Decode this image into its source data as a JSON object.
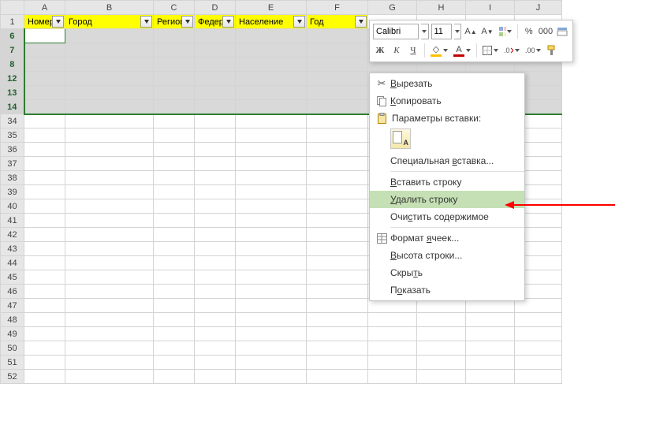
{
  "columns": [
    "A",
    "B",
    "C",
    "D",
    "E",
    "F",
    "G",
    "H",
    "I",
    "J"
  ],
  "header_row": "1",
  "titles": {
    "A": "Номер",
    "B": "Город",
    "C": "Регион",
    "D": "Федера",
    "E": "Население",
    "F": "Год"
  },
  "selected_rows": [
    "6",
    "7",
    "8",
    "12",
    "13",
    "14"
  ],
  "normal_rows": [
    "34",
    "35",
    "36",
    "37",
    "38",
    "39",
    "40",
    "41",
    "42",
    "43",
    "44",
    "45",
    "46",
    "47",
    "48",
    "49",
    "50",
    "51",
    "52"
  ],
  "mini_toolbar": {
    "font": "Calibri",
    "size": "11",
    "grow": "A",
    "shrink": "A",
    "percent": "%",
    "thousands": "000",
    "bold": "Ж",
    "italic": "К",
    "underline": "Ч",
    "font_color_letter": "A"
  },
  "context_menu": {
    "cut": "Вырезать",
    "copy": "Копировать",
    "paste_params": "Параметры вставки:",
    "paste_opt_letter": "А",
    "paste_special": "Специальная вставка...",
    "insert_row": "Вставить строку",
    "delete_row": "Удалить строку",
    "clear": "Очистить содержимое",
    "format_cells": "Формат ячеек...",
    "row_height": "Высота строки...",
    "hide": "Скрыть",
    "show": "Показать"
  }
}
